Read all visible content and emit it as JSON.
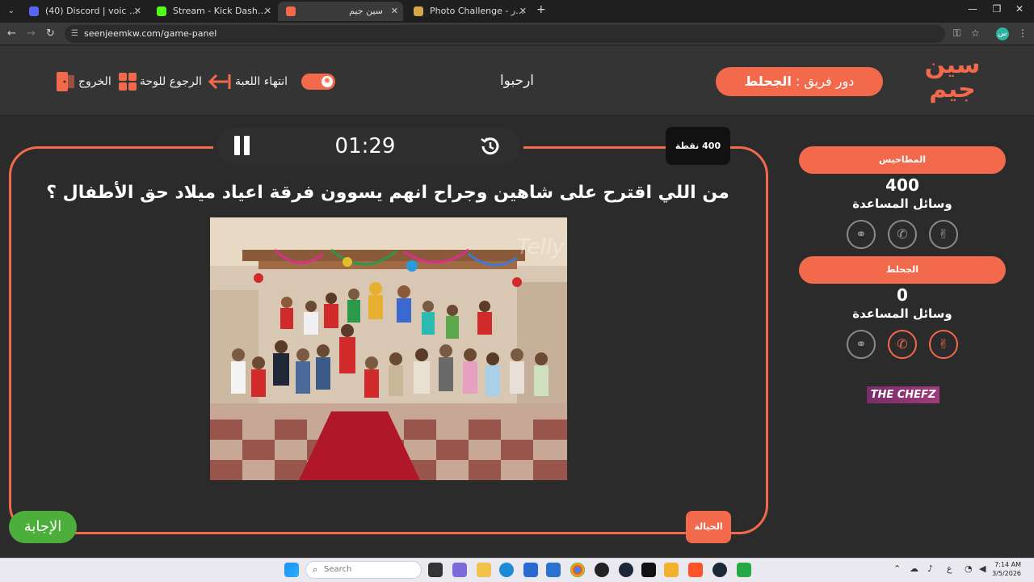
{
  "browser": {
    "tabs": [
      {
        "title": "(40) Discord | voic 1 | sbad",
        "favicon_color": "#5865f2"
      },
      {
        "title": "Stream - Kick Dashboard",
        "favicon_color": "#53fc18"
      },
      {
        "title": "سين جيم",
        "favicon_color": "#f26a4b"
      },
      {
        "title": "Photo Challenge - تحدي الصور",
        "favicon_color": "#d4a84a"
      }
    ],
    "url": "seenjeemkw.com/game-panel",
    "profile_initial": "س"
  },
  "header": {
    "exit_label": "الخروج",
    "back_to_board_label": "الرجوع للوحة",
    "end_game_label": "انتهاء اللعبة",
    "welcome": "ارحبوا",
    "turn_prefix": "دور فريق :",
    "turn_team": "الجحلط",
    "logo_line1": "سين",
    "logo_line2": "جيم"
  },
  "question": {
    "points": "400 نقطة",
    "timer": "01:29",
    "text": "من اللي اقترح على شاهين وجراح انهم يسوون فرقة اعياد ميلاد حق الأطفال ؟",
    "answer_button": "الإجابة",
    "lifeline_button": "الحيالة"
  },
  "teams": [
    {
      "name": "المطاحيس",
      "score": "400",
      "aids_label": "وسائل المساعدة",
      "aids": [
        {
          "icon": "two-rings-icon",
          "active": false
        },
        {
          "icon": "phone-icon",
          "active": false
        },
        {
          "icon": "victory-hand-icon",
          "active": false
        }
      ]
    },
    {
      "name": "الجحلط",
      "score": "0",
      "aids_label": "وسائل المساعدة",
      "aids": [
        {
          "icon": "two-rings-icon",
          "active": false
        },
        {
          "icon": "phone-icon",
          "active": true
        },
        {
          "icon": "victory-hand-icon",
          "active": true
        }
      ]
    }
  ],
  "sponsor": "THE CHEFZ",
  "taskbar": {
    "search_placeholder": "Search",
    "time": "7:14 AM",
    "date": "3/5/2026"
  },
  "colors": {
    "accent": "#f26a4b",
    "answer_green": "#4caf3c",
    "background": "#2b2b2b"
  }
}
